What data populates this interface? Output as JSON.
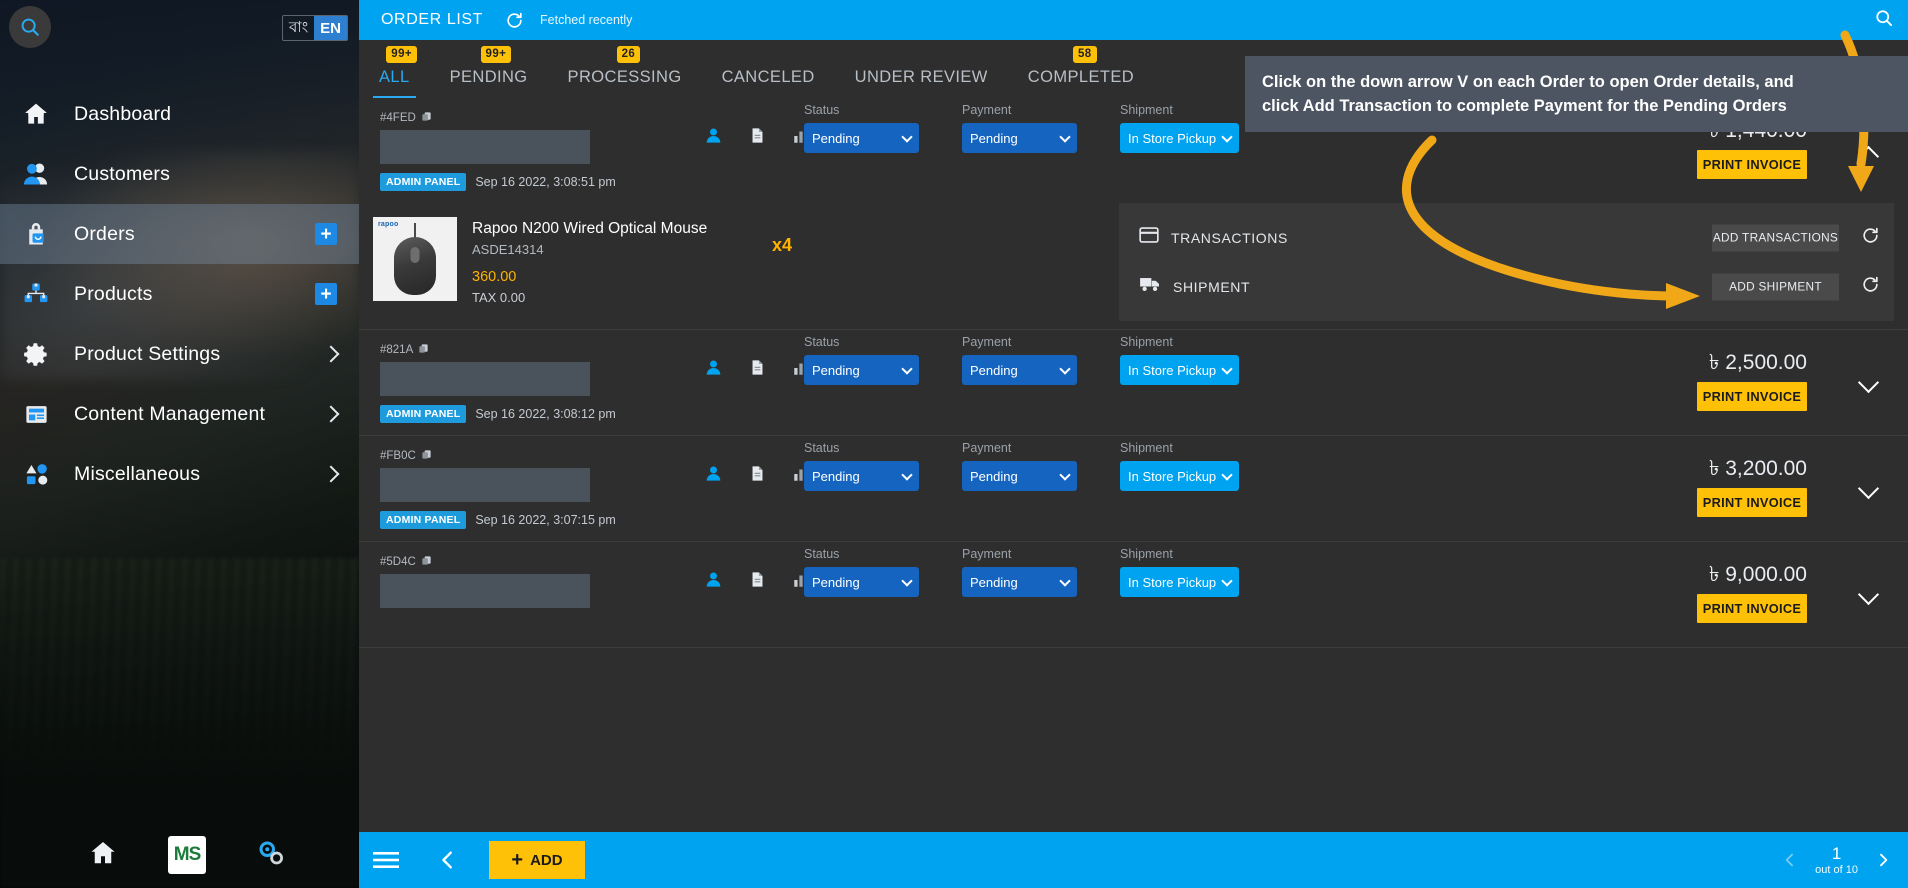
{
  "sidebar": {
    "search_icon": "search-icon",
    "language": {
      "options": [
        "বাং",
        "EN"
      ],
      "selected": "EN"
    },
    "items": [
      {
        "label": "Dashboard",
        "icon": "home-icon",
        "active": false,
        "accessory": "none"
      },
      {
        "label": "Customers",
        "icon": "users-icon",
        "active": false,
        "accessory": "none"
      },
      {
        "label": "Orders",
        "icon": "shopping-bag-icon",
        "active": true,
        "accessory": "plus"
      },
      {
        "label": "Products",
        "icon": "boxes-icon",
        "active": false,
        "accessory": "plus"
      },
      {
        "label": "Product Settings",
        "icon": "gear-icon",
        "active": false,
        "accessory": "chevron"
      },
      {
        "label": "Content Management",
        "icon": "newspaper-icon",
        "active": false,
        "accessory": "chevron"
      },
      {
        "label": "Miscellaneous",
        "icon": "shapes-icon",
        "active": false,
        "accessory": "chevron"
      }
    ],
    "bottom": {
      "home_icon": "home-icon",
      "logo_text": "MS",
      "settings_icon": "gears-icon"
    }
  },
  "topbar": {
    "title": "ORDER LIST",
    "sync_icon": "refresh-icon",
    "sync_text": "Fetched recently",
    "search_icon": "search-icon"
  },
  "tabs": [
    {
      "label": "ALL",
      "badge": "99+",
      "active": true
    },
    {
      "label": "PENDING",
      "badge": "99+",
      "active": false
    },
    {
      "label": "PROCESSING",
      "badge": "26",
      "active": false
    },
    {
      "label": "CANCELED",
      "badge": "",
      "active": false
    },
    {
      "label": "UNDER REVIEW",
      "badge": "",
      "active": false
    },
    {
      "label": "COMPLETED",
      "badge": "58",
      "active": false
    }
  ],
  "tooltip": {
    "line1": "Click on the down arrow V on each Order to open Order details, and",
    "line2": "click Add Transaction to complete Payment for the Pending Orders"
  },
  "field_labels": {
    "status": "Status",
    "payment": "Payment",
    "shipment": "Shipment"
  },
  "buttons": {
    "print_invoice": "PRINT INVOICE",
    "add_transactions": "ADD TRANSACTIONS",
    "add_shipment": "ADD SHIPMENT",
    "add": "ADD"
  },
  "expanded_panel": {
    "transactions_label": "TRANSACTIONS",
    "transactions_icon": "credit-card-icon",
    "shipment_label": "SHIPMENT",
    "shipment_icon": "truck-icon",
    "refresh_icon": "refresh-icon"
  },
  "orders": [
    {
      "id": "#4FED",
      "source": "ADMIN PANEL",
      "date": "Sep 16 2022, 3:08:51 pm",
      "status": "Pending",
      "payment": "Pending",
      "shipment": "In Store Pickup",
      "amount": "৳ 1,440.00",
      "expanded": true,
      "product": {
        "brand": "rapoo",
        "name": "Rapoo N200 Wired Optical Mouse",
        "sku": "ASDE14314",
        "price": "360.00",
        "tax": "TAX 0.00",
        "qty": "x4"
      }
    },
    {
      "id": "#821A",
      "source": "ADMIN PANEL",
      "date": "Sep 16 2022, 3:08:12 pm",
      "status": "Pending",
      "payment": "Pending",
      "shipment": "In Store Pickup",
      "amount": "৳ 2,500.00",
      "expanded": false
    },
    {
      "id": "#FB0C",
      "source": "ADMIN PANEL",
      "date": "Sep 16 2022, 3:07:15 pm",
      "status": "Pending",
      "payment": "Pending",
      "shipment": "In Store Pickup",
      "amount": "৳ 3,200.00",
      "expanded": false
    },
    {
      "id": "#5D4C",
      "source": "ADMIN PANEL",
      "date": "",
      "status": "Pending",
      "payment": "Pending",
      "shipment": "In Store Pickup",
      "amount": "৳ 9,000.00",
      "expanded": false
    }
  ],
  "bottombar": {
    "menu_icon": "hamburger-icon",
    "back_icon": "chevron-left-icon",
    "page_number": "1",
    "page_total": "out of 10",
    "prev_icon": "chevron-left-icon",
    "next_icon": "chevron-right-icon"
  },
  "colors": {
    "accent_blue": "#00a3f0",
    "amber": "#ffc107",
    "select_blue": "#1565c0",
    "tooltip_bg": "#4c5561",
    "arrow_orange": "#f0a818"
  }
}
